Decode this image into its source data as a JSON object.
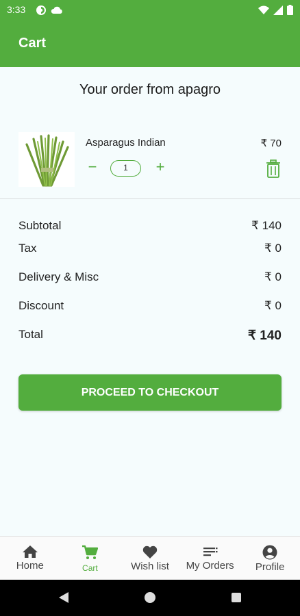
{
  "status_bar": {
    "time": "3:33"
  },
  "app_bar": {
    "title": "Cart"
  },
  "order": {
    "heading": "Your order from apagro"
  },
  "cart_items": [
    {
      "name": "Asparagus Indian",
      "price": "₹ 70",
      "quantity": "1"
    }
  ],
  "summary": {
    "subtotal_label": "Subtotal",
    "subtotal_value": "₹ 140",
    "tax_label": "Tax",
    "tax_value": "₹ 0",
    "delivery_label": "Delivery & Misc",
    "delivery_value": "₹ 0",
    "discount_label": "Discount",
    "discount_value": "₹ 0",
    "total_label": "Total",
    "total_value": "₹ 140"
  },
  "checkout": {
    "label": "PROCEED TO CHECKOUT"
  },
  "bottom_nav": {
    "items": [
      {
        "label": "Home",
        "icon": "home-icon"
      },
      {
        "label": "Cart",
        "icon": "cart-icon",
        "active": true
      },
      {
        "label": "Wish list",
        "icon": "heart-icon"
      },
      {
        "label": "My Orders",
        "icon": "list-icon"
      },
      {
        "label": "Profile",
        "icon": "account-icon"
      }
    ]
  },
  "colors": {
    "accent": "#53ad3e",
    "background": "#f5fcfd"
  }
}
